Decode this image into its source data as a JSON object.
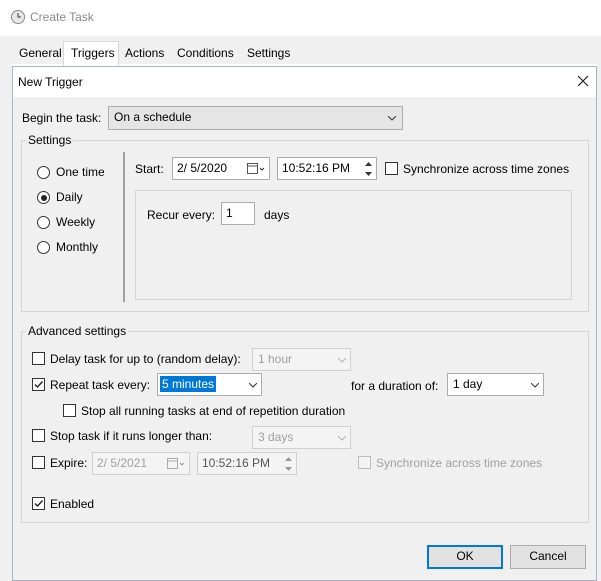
{
  "parent": {
    "title": "Create Task",
    "tabs": [
      "General",
      "Triggers",
      "Actions",
      "Conditions",
      "Settings"
    ],
    "active_tab": "Triggers"
  },
  "dialog": {
    "title": "New Trigger",
    "begin_label": "Begin the task:",
    "begin_value": "On a schedule",
    "settings_title": "Settings",
    "schedule_options": [
      "One time",
      "Daily",
      "Weekly",
      "Monthly"
    ],
    "selected_schedule": "Daily",
    "start_label": "Start:",
    "start_date": "2/ 5/2020",
    "start_time": "10:52:16 PM",
    "sync_label": "Synchronize across time zones",
    "recur_label": "Recur every:",
    "recur_value": "1",
    "recur_unit": "days",
    "advanced_title": "Advanced settings",
    "delay_label": "Delay task for up to (random delay):",
    "delay_value": "1 hour",
    "repeat_label": "Repeat task every:",
    "repeat_value": "5 minutes",
    "duration_label": "for a duration of:",
    "duration_value": "1 day",
    "stop_running_label": "Stop all running tasks at end of repetition duration",
    "stop_longer_label": "Stop task if it runs longer than:",
    "stop_longer_value": "3 days",
    "expire_label": "Expire:",
    "expire_date": "2/ 5/2021",
    "expire_time": "10:52:16 PM",
    "expire_sync_label": "Synchronize across time zones",
    "enabled_label": "Enabled",
    "ok_label": "OK",
    "cancel_label": "Cancel"
  },
  "state": {
    "daily_selected": true,
    "sync_checked": false,
    "delay_checked": false,
    "repeat_checked": true,
    "stop_running_checked": false,
    "stop_longer_checked": false,
    "expire_checked": false,
    "expire_sync_checked": false,
    "enabled_checked": true
  },
  "colors": {
    "dialog_bg": "#f0f0f0",
    "accent": "#0078d7",
    "disabled_text": "#a0a0a0"
  }
}
